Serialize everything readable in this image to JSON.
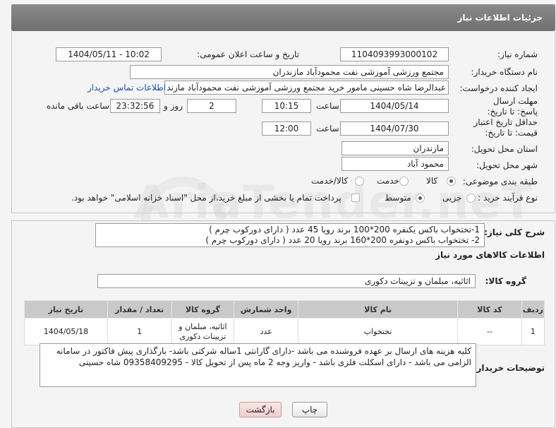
{
  "header": {
    "title": "جزئیات اطلاعات نیاز"
  },
  "form": {
    "need_number_label": "شماره نیاز:",
    "need_number": "1104093993000102",
    "announce_label": "تاریخ و ساعت اعلان عمومی:",
    "announce_value": "1404/05/11 - 10:02",
    "buyer_org_label": "نام دستگاه خریدار:",
    "buyer_org": "مجتمع ورزشی آموزشی نفت محمودآباد مازندران",
    "creator_label": "ایجاد کننده درخواست:",
    "creator": "عبدالرضا شاه حسینی مامور خرید مجتمع ورزشی آموزشی نفت محمودآباد مازند",
    "contact_link": "اطلاعات تماس خریدار",
    "reply_deadline_label": "مهلت ارسال پاسخ: تا تاریخ:",
    "reply_date": "1404/05/14",
    "time_label": "ساعت",
    "reply_time": "10:15",
    "days_value": "2",
    "days_label": "روز و",
    "remaining_time": "23:32:56",
    "remaining_label": "ساعت باقی مانده",
    "price_validity_label": "حداقل تاریخ اعتبار قیمت: تا تاریخ:",
    "price_date": "1404/07/30",
    "price_time": "12:00",
    "province_label": "استان محل تحویل:",
    "province": "مازندران",
    "city_label": "شهر محل تحویل:",
    "city": "محمود آباد",
    "category_label": "طبقه بندی موضوعی:",
    "category_options": [
      "کالا",
      "خدمت",
      "کالا/خدمت"
    ],
    "process_label": "نوع فرآیند خرید :",
    "process_options": [
      "جزیی",
      "متوسط"
    ],
    "payment_note": "پرداخت تمام یا بخشی از مبلغ خرید،از محل \"اسناد خزانه اسلامی\" خواهد بود."
  },
  "details": {
    "general_desc_label": "شرح کلی نیاز:",
    "general_desc_line1": "1-تختخواب باکس یکنفره 200*100 برند رویا   45 عدد ( دارای دورکوب چرم  )",
    "general_desc_line2": "2- تختخواب باکس دونفره 200*160 برند رویا  20 عدد ( دارای دورکوب چرم )",
    "goods_info_title": "اطلاعات کالاهای مورد نیاز",
    "goods_group_label": "گروه کالا:",
    "goods_group": "اثاثیه، مبلمان و تزیینات دکوری"
  },
  "table": {
    "headers": [
      "ردیف",
      "کد کالا",
      "نام کالا",
      "واحد شمارش",
      "گروه کالا",
      "تعداد / مقدار",
      "تاریخ نیاز"
    ],
    "rows": [
      [
        "1",
        "--",
        "تختخواب",
        "عدد",
        "اثاثیه، مبلمان و تزیینات دکوری",
        "1",
        "1404/05/18"
      ]
    ]
  },
  "buyer_notes": {
    "label": "توضیحات خریدار:",
    "line1": "کلیه هزینه های ارسال بر عهده فروشنده می باشد -دارای گارانتی 1ساله شرکتی باشد- بارگذاری پیش فاکتور در سامانه",
    "line2": "الزامی می باشد - دارای اسکلت فلزی باشد - واریز وجه 2 ماه پس از تحویل کالا - 09358409295 شاه حسینی"
  },
  "buttons": {
    "print": "چاپ",
    "back": "بازگشت"
  },
  "watermark": "AriaTender.neT",
  "colors": {
    "header": "#7c7c7c",
    "link": "#1a4ea8",
    "back_button": "#f6d6d6"
  }
}
